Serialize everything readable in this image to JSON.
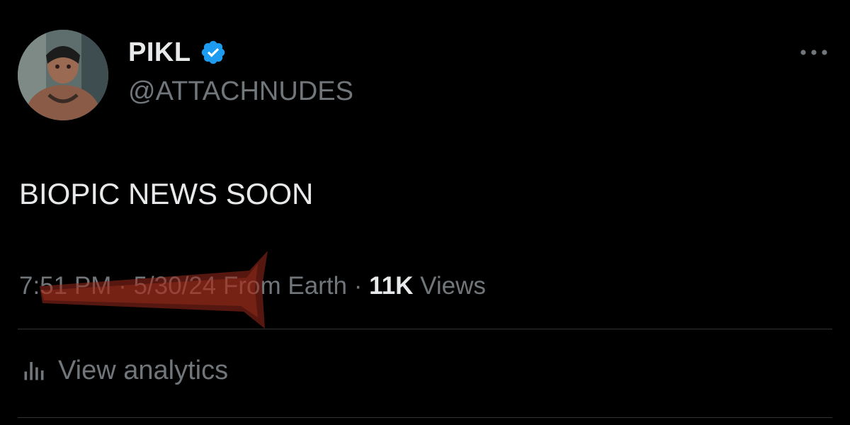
{
  "author": {
    "display_name": "PIKL",
    "handle": "@ATTACHNUDES",
    "verified": true
  },
  "icons": {
    "verified": "verified-badge-icon",
    "more": "more-horizontal-icon",
    "analytics": "bar-chart-icon"
  },
  "tweet": {
    "text": "BIOPIC NEWS SOON"
  },
  "meta": {
    "time_hour": "7:",
    "time_rest": "51 PM",
    "sep1": " · ",
    "date": "5/30/24",
    "source": " From Earth",
    "sep2": " · ",
    "views_count": "11K",
    "views_label": " Views"
  },
  "analytics": {
    "label": "View analytics"
  },
  "colors": {
    "background": "#000000",
    "text_primary": "#e7e9ea",
    "text_secondary": "#71767b",
    "verified_blue": "#1d9bf0",
    "divider": "#2f3336",
    "redaction_red": "#9b2a1c"
  }
}
